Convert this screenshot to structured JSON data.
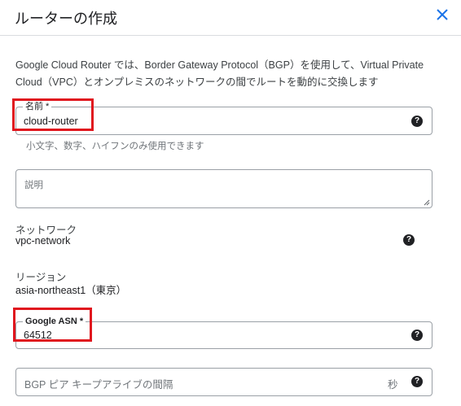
{
  "dialog": {
    "title": "ルーターの作成",
    "close_icon": "close-icon",
    "description": "Google Cloud Router では、Border Gateway Protocol（BGP）を使用して、Virtual Private Cloud（VPC）とオンプレミスのネットワークの間でルートを動的に交換します"
  },
  "name_field": {
    "label": "名前 *",
    "value": "cloud-router",
    "hint": "小文字、数字、ハイフンのみ使用できます",
    "help_icon": "help-icon"
  },
  "description_field": {
    "placeholder": "説明"
  },
  "network": {
    "label": "ネットワーク",
    "value": "vpc-network",
    "help_icon": "help-icon"
  },
  "region": {
    "label": "リージョン",
    "value": "asia-northeast1（東京）"
  },
  "asn_field": {
    "label": "Google ASN *",
    "value": "64512",
    "help_icon": "help-icon"
  },
  "bgp_field": {
    "placeholder": "BGP ピア キープアライブの間隔",
    "suffix": "秒",
    "help_icon": "help-icon"
  },
  "colors": {
    "accent": "#1a73e8",
    "highlight": "#e0161e"
  }
}
